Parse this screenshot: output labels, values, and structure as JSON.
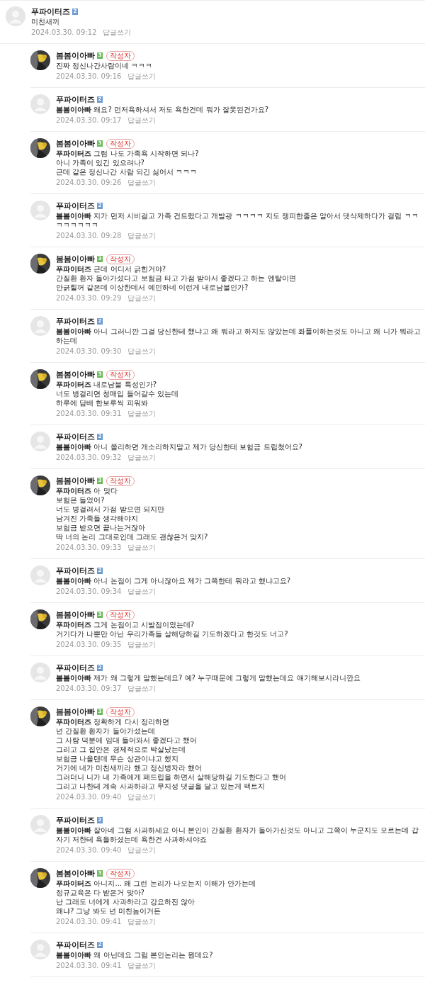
{
  "comment": {
    "author": "푸파이터즈",
    "grade": "2",
    "color": "#6c9bd2",
    "kind": "default",
    "lines": [
      "미친새끼"
    ],
    "date": "2024.03.30. 09:12",
    "reply_link": "답글쓰기"
  },
  "replies": [
    {
      "author": "봄봄이아빠",
      "grade": "3",
      "color": "#6cbb5a",
      "writer_badge": "작성자",
      "lines": [
        "진짜 정신나간사람이네 ㅋㅋㅋ"
      ],
      "date": "2024.03.30. 09:16",
      "reply_link": "답글쓰기"
    },
    {
      "author": "푸파이터즈",
      "grade": "2",
      "color": "#6c9bd2",
      "kind": "default",
      "mention": "봄봄이아빠",
      "lines": [
        "왜요? 먼저욕하셔서 저도 욕한건데 뭐가 잘못된건가요?"
      ],
      "date": "2024.03.30. 09:17",
      "reply_link": "답글쓰기"
    },
    {
      "author": "봄봄이아빠",
      "grade": "3",
      "color": "#6cbb5a",
      "writer_badge": "작성자",
      "mention": "푸파이터즈",
      "lines": [
        "그럼 나도 가족욕 시작하면 되나?",
        "아니 가족이 있긴 있으려나?",
        "근데 같은 정신나간 사람 되긴 싫어서 ㅋㅋㅋ"
      ],
      "date": "2024.03.30. 09:26",
      "reply_link": "답글쓰기"
    },
    {
      "author": "푸파이터즈",
      "grade": "2",
      "color": "#6c9bd2",
      "kind": "default",
      "mention": "봄봄이아빠",
      "lines": [
        "지가 먼저 시비걸고 가족 건드렸다고 개발광 ㅋㅋㅋㅋ 지도 쟁피한줄은 알아서 댓삭제하다가 걸림 ㅋㅋㅋㅋㅋㅋㅋㅋ"
      ],
      "date": "2024.03.30. 09:28",
      "reply_link": "답글쓰기"
    },
    {
      "author": "봄봄이아빠",
      "grade": "3",
      "color": "#6cbb5a",
      "writer_badge": "작성자",
      "mention": "푸파이터즈",
      "lines": [
        "근데 어디서 긁힌거야?",
        "간질환 환자 돌아가셨다고 보험금 타고 가점 받아서 좋겠다고 하는 멘탈이면",
        "안긁힐꺼 같은데 이상한데서 예민하네 이런게 내로남불인가?"
      ],
      "date": "2024.03.30. 09:29",
      "reply_link": "답글쓰기"
    },
    {
      "author": "푸파이터즈",
      "grade": "2",
      "color": "#6c9bd2",
      "kind": "default",
      "mention": "봄봄이아빠",
      "lines": [
        "아니 그러니깐 그걸 당신한테 했냐고 왜 뭐라고 하지도 않았는데 화풀이하는것도 아니고 왜 니가 뭐라고 하는데"
      ],
      "date": "2024.03.30. 09:30",
      "reply_link": "답글쓰기"
    },
    {
      "author": "봄봄이아빠",
      "grade": "3",
      "color": "#6cbb5a",
      "writer_badge": "작성자",
      "mention": "푸파이터즈",
      "lines": [
        "내로남불 특성인가?",
        "너도 병걸리면 청매입 들어갈수 있는데",
        "하루에 담배 한보루씩 피워봐"
      ],
      "date": "2024.03.30. 09:31",
      "reply_link": "답글쓰기"
    },
    {
      "author": "푸파이터즈",
      "grade": "2",
      "color": "#6c9bd2",
      "kind": "default",
      "mention": "봄봄이아빠",
      "lines": [
        "아니 쫄리하면 개소리하지말고 제가 당신한테 보험금 드립쳤어요?"
      ],
      "date": "2024.03.30. 09:32",
      "reply_link": "답글쓰기"
    },
    {
      "author": "봄봄이아빠",
      "grade": "3",
      "color": "#6cbb5a",
      "writer_badge": "작성자",
      "mention": "푸파이터즈",
      "lines": [
        "아 맞다",
        "보험은 들었어?",
        "너도 병걸려서 가점 받으면 되지만",
        "남겨진 가족들 생각해야지",
        "보험금 받으면 끝나는거잖아",
        "딱 너의 논리 그대로인데 그래도 괜찮은거 맞지?"
      ],
      "date": "2024.03.30. 09:33",
      "reply_link": "답글쓰기"
    },
    {
      "author": "푸파이터즈",
      "grade": "2",
      "color": "#6c9bd2",
      "kind": "default",
      "mention": "봄봄이아빠",
      "lines": [
        "아니 논점이 그게 아니잖아요 제가 그쪽한테 뭐라고 했냐고요?"
      ],
      "date": "2024.03.30. 09:34",
      "reply_link": "답글쓰기"
    },
    {
      "author": "봄봄이아빠",
      "grade": "3",
      "color": "#6cbb5a",
      "writer_badge": "작성자",
      "mention": "푸파이터즈",
      "lines": [
        "그게 논점이고 시발점이였는데?",
        "거기다가 나뿐만 아닌 우리가족들 살해당하길 기도하겠다고 한것도 너고?"
      ],
      "date": "2024.03.30. 09:35",
      "reply_link": "답글쓰기"
    },
    {
      "author": "푸파이터즈",
      "grade": "2",
      "color": "#6c9bd2",
      "kind": "default",
      "mention": "봄봄이아빠",
      "lines": [
        "제가 왜 그렇게 말했는데요? 예? 누구때문에 그렇게 말했는데요 얘기해보시라니깐요"
      ],
      "date": "2024.03.30. 09:37",
      "reply_link": "답글쓰기"
    },
    {
      "author": "봄봄이아빠",
      "grade": "3",
      "color": "#6cbb5a",
      "writer_badge": "작성자",
      "mention": "푸파이터즈",
      "lines": [
        "정확하게 다시 정리하면",
        "넌 간질환 환자가 돌아가셨는데",
        "그 사람 덕분에 임대 들어와서 좋겠다고 했어",
        "그리고 그 집안은 경제적으로 박살났는데",
        "보험금 나올텐데 무슨 상관이냐고 했지",
        "거기에 내가 미친새끼라 했고 정신병자라 했어",
        "그러더니 니가 내 가족에게 패드립을 하면서 살해당하길 기도한다고 했어",
        "그리고 나한테 계속 사과하라고 무지성 댓글을 달고 있는게 팩트지"
      ],
      "date": "2024.03.30. 09:40",
      "reply_link": "답글쓰기"
    },
    {
      "author": "푸파이터즈",
      "grade": "2",
      "color": "#6c9bd2",
      "kind": "default",
      "mention": "봄봄이아빠",
      "lines": [
        "잘아네 그럼 사과하세요 아니 본인이 간질환 환자가 돌아가신것도 아니고 그쪽이 누군지도 모르는데 갑자기 저한테 욕을하셨는데 욕한건 사과하셔야죠"
      ],
      "date": "2024.03.30. 09:40",
      "reply_link": "답글쓰기"
    },
    {
      "author": "봄봄이아빠",
      "grade": "3",
      "color": "#6cbb5a",
      "writer_badge": "작성자",
      "mention": "푸파이터즈",
      "lines": [
        "아니지... 왜 그런 논리가 나오는지 이해가 안가는데",
        "정규교육은 다 받은거 맞아?",
        "난 그래도 너에게 사과하라고 강요하진 않아",
        "왜냐? 그냥 봐도 넌 미친놈이거든"
      ],
      "date": "2024.03.30. 09:41",
      "reply_link": "답글쓰기"
    },
    {
      "author": "푸파이터즈",
      "grade": "2",
      "color": "#6c9bd2",
      "kind": "default",
      "mention": "봄봄이아빠",
      "lines": [
        "왜 아닌데요 그럼 본인논리는 뭔데요?"
      ],
      "date": "2024.03.30. 09:41",
      "reply_link": "답글쓰기"
    }
  ]
}
